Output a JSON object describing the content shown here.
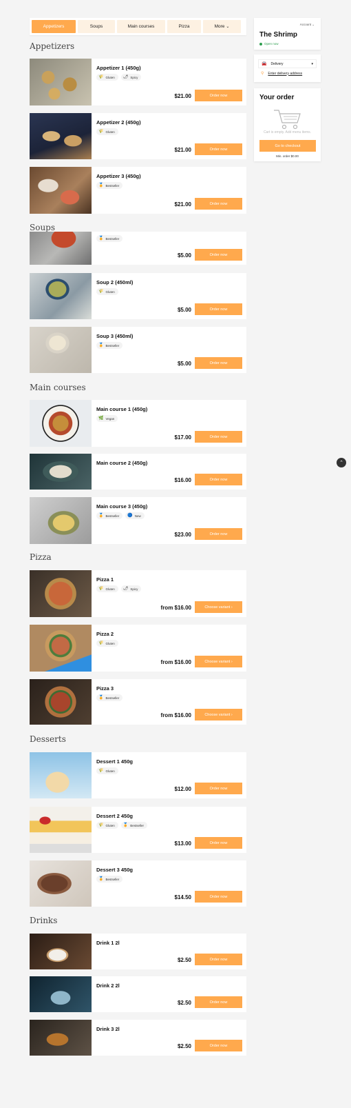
{
  "nav": {
    "categories": [
      "Appetizers",
      "Soups",
      "Main courses",
      "Pizza",
      "More"
    ]
  },
  "sidebar": {
    "account_label": "Account",
    "restaurant_name": "The Shrimp",
    "open_status": "Open now",
    "delivery_option": "Delivery",
    "address_link": "Enter delivery address",
    "order_title": "Your order",
    "empty_cart_text": "Cart is empty. Add menu items.",
    "checkout_label": "Go to checkout",
    "min_order": "Min. order $0.00"
  },
  "sections": {
    "appetizers": "Appetizers",
    "soups": "Soups",
    "main_courses": "Main courses",
    "pizza": "Pizza",
    "desserts": "Desserts",
    "drinks": "Drinks"
  },
  "tags": {
    "gluten": "Gluten",
    "spicy": "Spicy",
    "bestseller": "Bestseller",
    "vegan": "Vegan",
    "new": "New"
  },
  "items": [
    {
      "title": "Appetizer 1 (450g)",
      "price": "$21.00",
      "button": "Order now"
    },
    {
      "title": "Appetizer 2 (450g)",
      "price": "$21.00",
      "button": "Order now"
    },
    {
      "title": "Appetizer 3 (450g)",
      "price": "$21.00",
      "button": "Order now"
    },
    {
      "title": "",
      "price": "$5.00",
      "button": "Order now"
    },
    {
      "title": "Soup 2 (450ml)",
      "price": "$5.00",
      "button": "Order now"
    },
    {
      "title": "Soup 3 (450ml)",
      "price": "$5.00",
      "button": "Order now"
    },
    {
      "title": "Main course 1 (450g)",
      "price": "$17.00",
      "button": "Order now"
    },
    {
      "title": "Main course 2 (450g)",
      "price": "$16.00",
      "button": "Order now"
    },
    {
      "title": "Main course 3 (450g)",
      "price": "$23.00",
      "button": "Order now"
    },
    {
      "title": "Pizza 1",
      "price": "from $16.00",
      "button": "Choose variant ›"
    },
    {
      "title": "Pizza 2",
      "price": "from $16.00",
      "button": "Choose variant ›"
    },
    {
      "title": "Pizza 3",
      "price": "from $16.00",
      "button": "Choose variant ›"
    },
    {
      "title": "Dessert 1 450g",
      "price": "$12.00",
      "button": "Order now"
    },
    {
      "title": "Dessert 2 450g",
      "price": "$13.00",
      "button": "Order now"
    },
    {
      "title": "Dessert 3 450g",
      "price": "$14.50",
      "button": "Order now"
    },
    {
      "title": "Drink 1 2l",
      "price": "$2.50",
      "button": "Order now"
    },
    {
      "title": "Drink 2 2l",
      "price": "$2.50",
      "button": "Order now"
    },
    {
      "title": "Drink 3 2l",
      "price": "$2.50",
      "button": "Order now"
    }
  ],
  "colors": {
    "accent": "#ffa94d",
    "open": "#2e9e4f"
  }
}
